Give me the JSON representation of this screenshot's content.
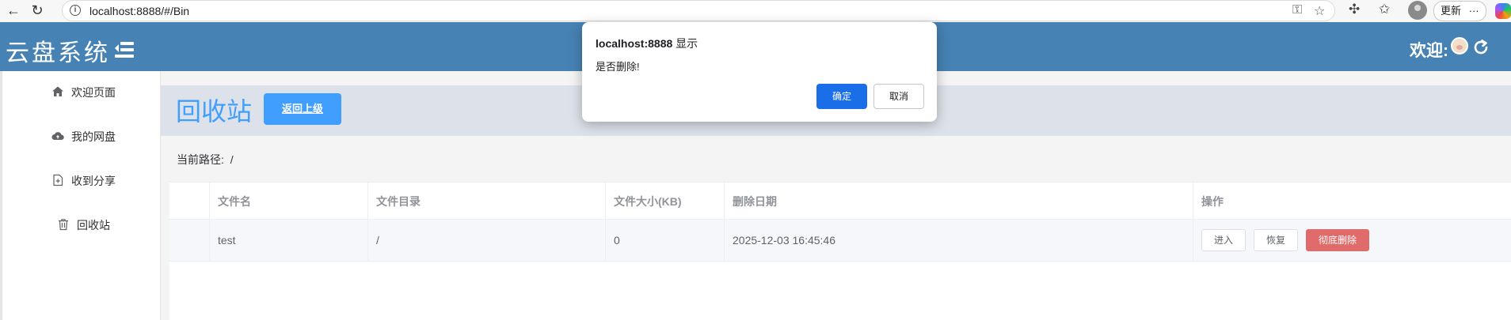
{
  "browser": {
    "url": "localhost:8888/#/Bin",
    "update_label": "更新",
    "more_label": "···"
  },
  "header": {
    "logo": "云盘系统",
    "welcome": "欢迎:"
  },
  "sidebar": {
    "items": [
      {
        "label": "欢迎页面",
        "icon": "home-icon"
      },
      {
        "label": "我的网盘",
        "icon": "cloud-icon"
      },
      {
        "label": "收到分享",
        "icon": "document-add-icon"
      },
      {
        "label": "回收站",
        "icon": "trash-icon"
      }
    ]
  },
  "main": {
    "title": "回收站",
    "back_button": "返回上级",
    "path_label": "当前路径:",
    "path_value": "/"
  },
  "table": {
    "columns": [
      "文件名",
      "文件目录",
      "文件大小(KB)",
      "删除日期",
      "操作"
    ],
    "rows": [
      {
        "name": "test",
        "dir": "/",
        "size": "0",
        "date": "2025-12-03 16:45:46"
      }
    ],
    "actions": {
      "enter": "进入",
      "restore": "恢复",
      "delete": "彻底删除"
    }
  },
  "dialog": {
    "title_host": "localhost:8888",
    "title_suffix": "显示",
    "message": "是否删除!",
    "ok": "确定",
    "cancel": "取消"
  },
  "colors": {
    "header_bg": "#4682b4",
    "primary": "#409eff",
    "danger": "#e06b6b",
    "dialog_ok": "#1a6ee8"
  }
}
